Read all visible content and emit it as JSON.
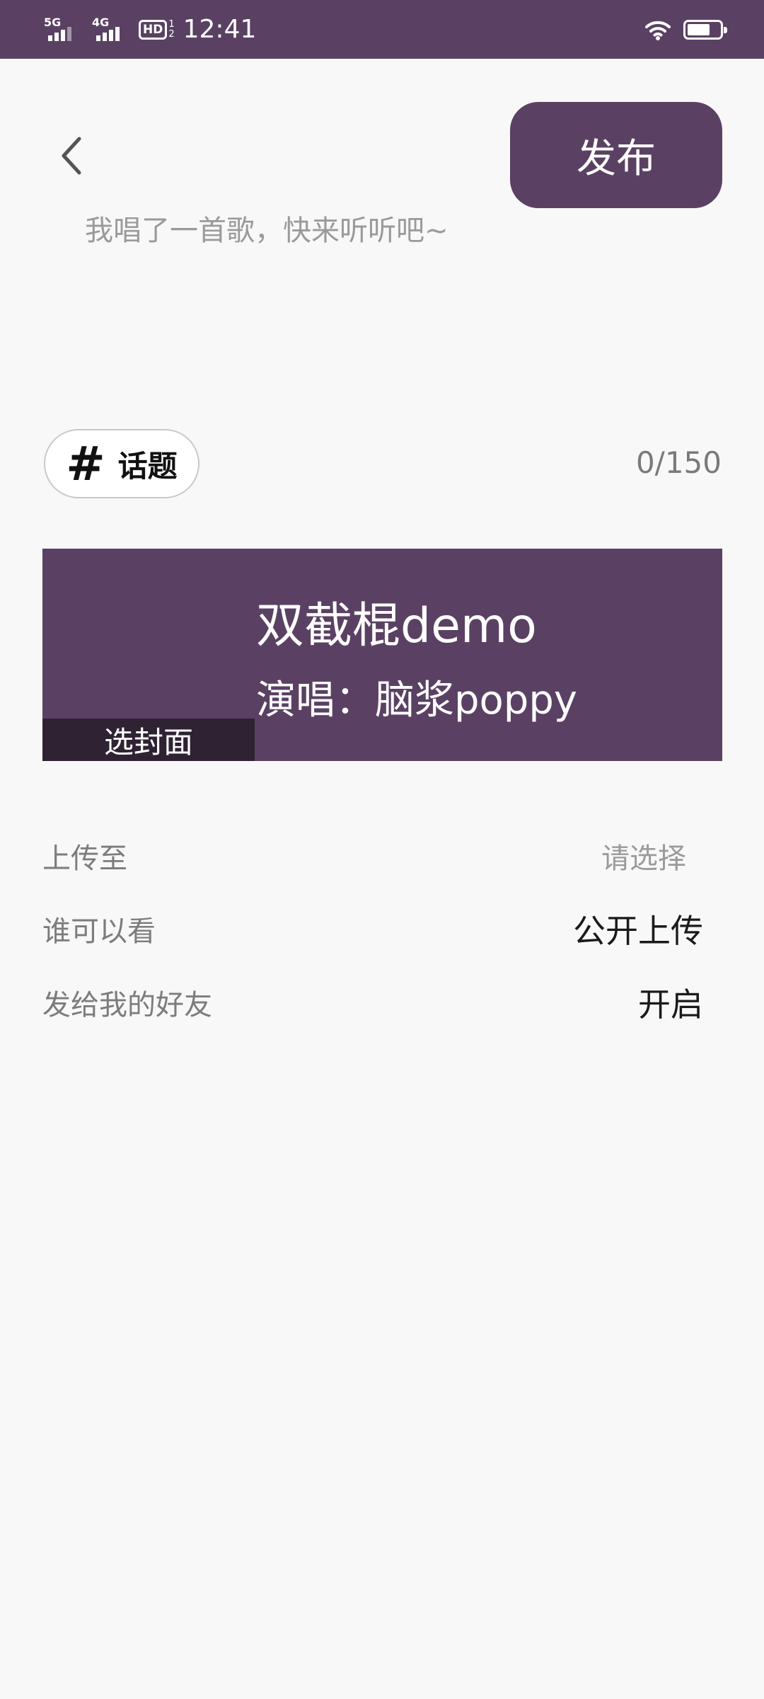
{
  "status_bar": {
    "network1": "5G",
    "network2": "4G",
    "hd": "HD",
    "hd_sub_top": "1",
    "hd_sub_bottom": "2",
    "time": "12:41",
    "battery_level": 0.7
  },
  "header": {
    "publish_label": "发布",
    "caption_placeholder": "我唱了一首歌，快来听听吧~"
  },
  "topic": {
    "hash": "#",
    "label": "话题",
    "counter": "0/150"
  },
  "song_card": {
    "title": "双截棍demo",
    "singer": "演唱：脑浆poppy",
    "cover_label": "选封面"
  },
  "settings": [
    {
      "label": "上传至",
      "value": "请选择"
    },
    {
      "label": "谁可以看",
      "value": "公开上传"
    },
    {
      "label": "发给我的好友",
      "value": "开启"
    }
  ],
  "colors": {
    "accent": "#5a4163",
    "background": "#f8f8f8"
  }
}
